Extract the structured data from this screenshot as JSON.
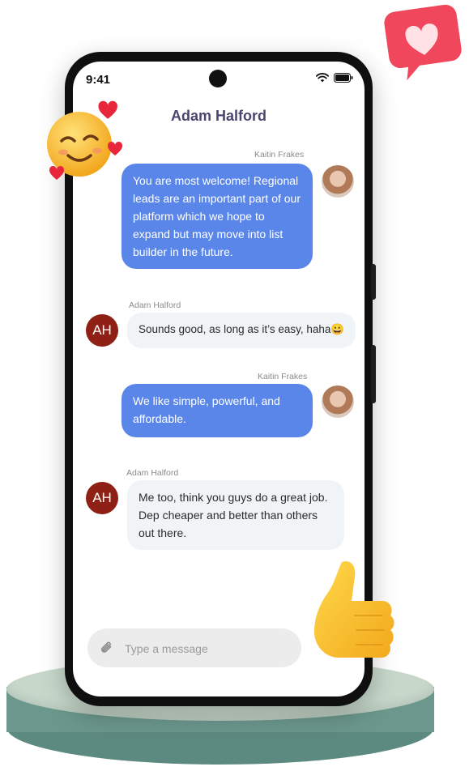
{
  "status_bar": {
    "time": "9:41"
  },
  "chat": {
    "title": "Adam Halford",
    "messages": [
      {
        "sender": "Kaitin Frakes",
        "text": "You are most welcome! Regional leads are an important part of our platform which we hope to expand but may move into list builder in the future."
      },
      {
        "sender": "Adam Halford",
        "initials": "AH",
        "text": "Sounds good, as long as it’s easy, haha😀"
      },
      {
        "sender": "Kaitin Frakes",
        "text": "We like simple, powerful, and affordable."
      },
      {
        "sender": "Adam Halford",
        "initials": "AH",
        "text": "Me too, think you guys do a great job. Dep cheaper and better than others out there."
      }
    ]
  },
  "composer": {
    "placeholder": "Type a message",
    "icon": "paperclip-icon"
  },
  "decorations": [
    "heart-badge-icon",
    "smiling-face-hearts-emoji",
    "thumbs-up-emoji"
  ],
  "colors": {
    "outgoing_bubble": "#5a86e9",
    "incoming_bubble": "#f0f4f7",
    "avatar_initials_bg": "#8f2016",
    "title": "#4a4470"
  }
}
